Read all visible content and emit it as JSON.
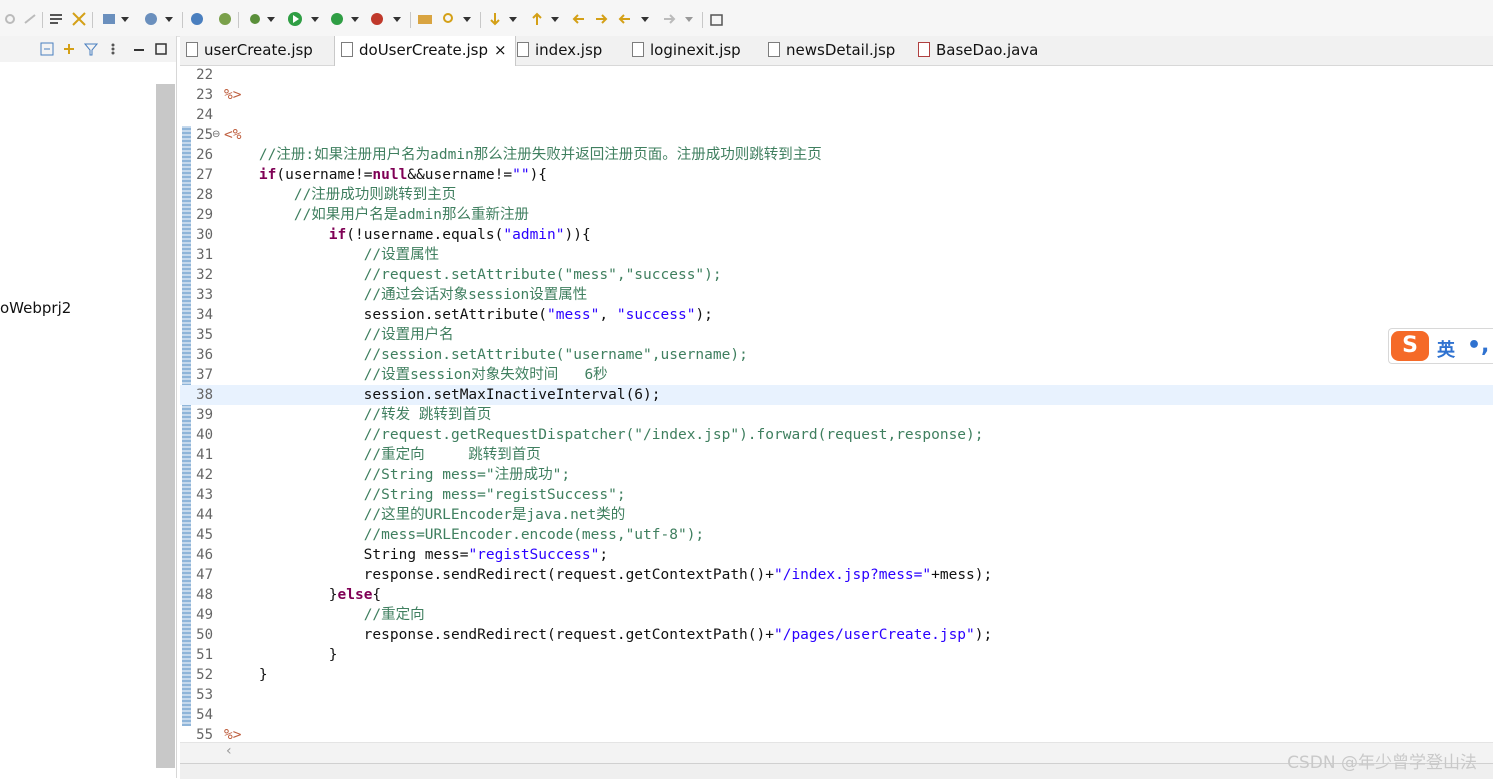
{
  "tabs": [
    {
      "label": "userCreate.jsp",
      "active": false
    },
    {
      "label": "doUserCreate.jsp",
      "active": true,
      "close": "×"
    },
    {
      "label": "index.jsp",
      "active": false
    },
    {
      "label": "loginexit.jsp",
      "active": false
    },
    {
      "label": "newsDetail.jsp",
      "active": false
    },
    {
      "label": "BaseDao.java",
      "active": false
    }
  ],
  "left_panel": {
    "tree_item": "oWebprj2"
  },
  "ime": {
    "logo": "S",
    "lang": "英",
    "punct": "•,"
  },
  "watermark": "CSDN @年少曾学登山法",
  "editor": {
    "current_line": 38,
    "lines": [
      {
        "n": "22",
        "segs": []
      },
      {
        "n": "23",
        "segs": [
          {
            "t": "%>",
            "c": "jsp"
          }
        ]
      },
      {
        "n": "24",
        "segs": []
      },
      {
        "n": "25",
        "fold": true,
        "segs": [
          {
            "t": "<%",
            "c": "jsp"
          }
        ]
      },
      {
        "n": "26",
        "segs": [
          {
            "t": "    "
          },
          {
            "t": "//注册:如果注册用户名为admin那么注册失败并返回注册页面。注册成功则跳转到主页",
            "c": "cm"
          }
        ]
      },
      {
        "n": "27",
        "segs": [
          {
            "t": "    "
          },
          {
            "t": "if",
            "c": "kw"
          },
          {
            "t": "(username!="
          },
          {
            "t": "null",
            "c": "kw"
          },
          {
            "t": "&&username!="
          },
          {
            "t": "\"\"",
            "c": "st"
          },
          {
            "t": "){"
          }
        ]
      },
      {
        "n": "28",
        "segs": [
          {
            "t": "        "
          },
          {
            "t": "//注册成功则跳转到主页",
            "c": "cm"
          }
        ]
      },
      {
        "n": "29",
        "segs": [
          {
            "t": "        "
          },
          {
            "t": "//如果用户名是admin那么重新注册",
            "c": "cm"
          }
        ]
      },
      {
        "n": "30",
        "segs": [
          {
            "t": "            "
          },
          {
            "t": "if",
            "c": "kw"
          },
          {
            "t": "(!username.equals("
          },
          {
            "t": "\"admin\"",
            "c": "st"
          },
          {
            "t": ")){"
          }
        ]
      },
      {
        "n": "31",
        "segs": [
          {
            "t": "                "
          },
          {
            "t": "//设置属性",
            "c": "cm"
          }
        ]
      },
      {
        "n": "32",
        "segs": [
          {
            "t": "                "
          },
          {
            "t": "//request.setAttribute(\"mess\",\"success\");",
            "c": "cm"
          }
        ]
      },
      {
        "n": "33",
        "segs": [
          {
            "t": "                "
          },
          {
            "t": "//通过会话对象session设置属性",
            "c": "cm"
          }
        ]
      },
      {
        "n": "34",
        "segs": [
          {
            "t": "                session.setAttribute("
          },
          {
            "t": "\"mess\"",
            "c": "st"
          },
          {
            "t": ", "
          },
          {
            "t": "\"success\"",
            "c": "st"
          },
          {
            "t": ");"
          }
        ]
      },
      {
        "n": "35",
        "segs": [
          {
            "t": "                "
          },
          {
            "t": "//设置用户名",
            "c": "cm"
          }
        ]
      },
      {
        "n": "36",
        "segs": [
          {
            "t": "                "
          },
          {
            "t": "//session.setAttribute(\"username\",username);",
            "c": "cm"
          }
        ]
      },
      {
        "n": "37",
        "segs": [
          {
            "t": "                "
          },
          {
            "t": "//设置session对象失效时间   6秒",
            "c": "cm"
          }
        ]
      },
      {
        "n": "38",
        "segs": [
          {
            "t": "                session.setMaxInactiveInterval(6);"
          }
        ]
      },
      {
        "n": "39",
        "segs": [
          {
            "t": "                "
          },
          {
            "t": "//转发 跳转到首页",
            "c": "cm"
          }
        ]
      },
      {
        "n": "40",
        "segs": [
          {
            "t": "                "
          },
          {
            "t": "//request.getRequestDispatcher(\"/index.jsp\").forward(request,response);",
            "c": "cm"
          }
        ]
      },
      {
        "n": "41",
        "segs": [
          {
            "t": "                "
          },
          {
            "t": "//重定向     跳转到首页",
            "c": "cm"
          }
        ]
      },
      {
        "n": "42",
        "segs": [
          {
            "t": "                "
          },
          {
            "t": "//String mess=\"注册成功\";",
            "c": "cm"
          }
        ]
      },
      {
        "n": "43",
        "segs": [
          {
            "t": "                "
          },
          {
            "t": "//String mess=\"registSuccess\";",
            "c": "cm"
          }
        ]
      },
      {
        "n": "44",
        "segs": [
          {
            "t": "                "
          },
          {
            "t": "//这里的URLEncoder是java.net类的",
            "c": "cm"
          }
        ]
      },
      {
        "n": "45",
        "segs": [
          {
            "t": "                "
          },
          {
            "t": "//mess=URLEncoder.encode(mess,\"utf-8\");",
            "c": "cm"
          }
        ]
      },
      {
        "n": "46",
        "segs": [
          {
            "t": "                String mess="
          },
          {
            "t": "\"registSuccess\"",
            "c": "st"
          },
          {
            "t": ";"
          }
        ]
      },
      {
        "n": "47",
        "segs": [
          {
            "t": "                response.sendRedirect(request.getContextPath()+"
          },
          {
            "t": "\"/index.jsp?mess=\"",
            "c": "st"
          },
          {
            "t": "+mess);"
          }
        ]
      },
      {
        "n": "48",
        "segs": [
          {
            "t": "            }"
          },
          {
            "t": "else",
            "c": "kw"
          },
          {
            "t": "{"
          }
        ]
      },
      {
        "n": "49",
        "segs": [
          {
            "t": "                "
          },
          {
            "t": "//重定向",
            "c": "cm"
          }
        ]
      },
      {
        "n": "50",
        "segs": [
          {
            "t": "                response.sendRedirect(request.getContextPath()+"
          },
          {
            "t": "\"/pages/userCreate.jsp\"",
            "c": "st"
          },
          {
            "t": ");"
          }
        ]
      },
      {
        "n": "51",
        "segs": [
          {
            "t": "            }"
          }
        ]
      },
      {
        "n": "52",
        "segs": [
          {
            "t": "    }"
          }
        ]
      },
      {
        "n": "53",
        "segs": []
      },
      {
        "n": "54",
        "segs": []
      },
      {
        "n": "55",
        "segs": [
          {
            "t": "%>",
            "c": "jsp"
          }
        ]
      }
    ]
  }
}
